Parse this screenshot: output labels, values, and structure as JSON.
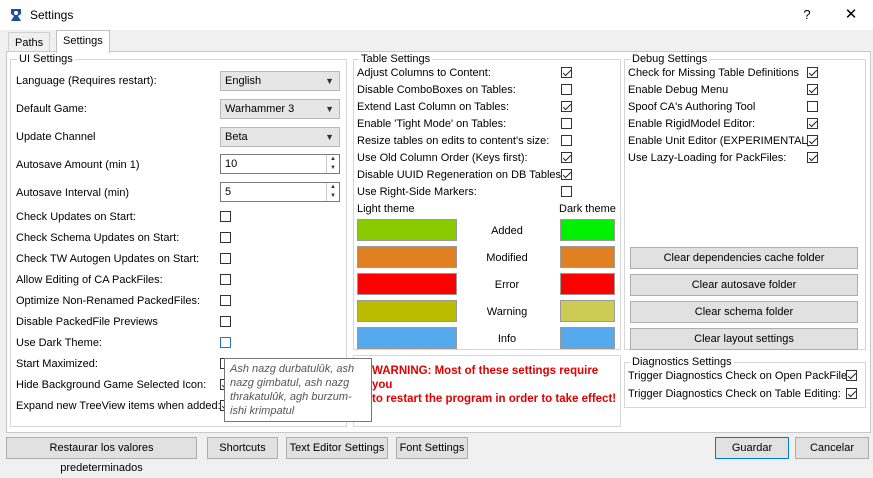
{
  "window": {
    "title": "Settings",
    "help": "?",
    "close": "✕",
    "icon": "app-logo-icon"
  },
  "tabs": [
    {
      "label": "Paths"
    },
    {
      "label": "Settings"
    }
  ],
  "ui_settings": {
    "title": "UI Settings",
    "language": {
      "label": "Language (Requires restart):",
      "value": "English"
    },
    "default_game": {
      "label": "Default Game:",
      "value": "Warhammer 3"
    },
    "update_channel": {
      "label": "Update Channel",
      "value": "Beta"
    },
    "autosave_amount": {
      "label": "Autosave Amount (min 1)",
      "value": "10"
    },
    "autosave_interval": {
      "label": "Autosave Interval (min)",
      "value": "5"
    },
    "checks": [
      {
        "label": "Check Updates on Start:",
        "checked": false
      },
      {
        "label": "Check Schema Updates on Start:",
        "checked": false
      },
      {
        "label": "Check TW Autogen Updates on Start:",
        "checked": false
      },
      {
        "label": "Allow Editing of CA PackFiles:",
        "checked": false
      },
      {
        "label": "Optimize Non-Renamed PackedFiles:",
        "checked": false
      },
      {
        "label": "Disable PackedFile Previews",
        "checked": false
      },
      {
        "label": "Use Dark Theme:",
        "checked": false
      },
      {
        "label": "Start Maximized:",
        "checked": false
      },
      {
        "label": "Hide Background Game Selected Icon:",
        "checked": true
      },
      {
        "label": "Expand new TreeView items when added:",
        "checked": true
      }
    ]
  },
  "table_settings": {
    "title": "Table Settings",
    "checks": [
      {
        "label": "Adjust Columns to Content:",
        "checked": true
      },
      {
        "label": "Disable ComboBoxes on Tables:",
        "checked": false
      },
      {
        "label": "Extend Last Column on Tables:",
        "checked": true
      },
      {
        "label": "Enable 'Tight Mode' on Tables:",
        "checked": false
      },
      {
        "label": "Resize tables on edits to content's size:",
        "checked": false
      },
      {
        "label": "Use Old Column Order (Keys first):",
        "checked": true
      },
      {
        "label": "Disable UUID Regeneration on DB Tables:",
        "checked": true
      },
      {
        "label": "Use Right-Side Markers:",
        "checked": false
      }
    ],
    "light_theme_label": "Light theme",
    "dark_theme_label": "Dark theme",
    "colors": [
      {
        "name": "Added",
        "light": "#88cc00",
        "dark": "#00f000"
      },
      {
        "name": "Modified",
        "light": "#e08020",
        "dark": "#e08020"
      },
      {
        "name": "Error",
        "light": "#ff0000",
        "dark": "#ff0000"
      },
      {
        "name": "Warning",
        "light": "#bbbb00",
        "dark": "#cccc55"
      },
      {
        "name": "Info",
        "light": "#55aaee",
        "dark": "#55aaee"
      }
    ],
    "warning_text_1": "WARNING: Most of these settings require you",
    "warning_text_2": "to restart the program in order to take effect!"
  },
  "debug_settings": {
    "title": "Debug Settings",
    "checks": [
      {
        "label": "Check for Missing Table Definitions",
        "checked": true
      },
      {
        "label": "Enable Debug Menu",
        "checked": true
      },
      {
        "label": "Spoof CA's Authoring Tool",
        "checked": false
      },
      {
        "label": "Enable RigidModel Editor:",
        "checked": true
      },
      {
        "label": "Enable Unit Editor (EXPERIMENTAL):",
        "checked": true
      },
      {
        "label": "Use Lazy-Loading for PackFiles:",
        "checked": true
      }
    ],
    "buttons": [
      "Clear dependencies cache folder",
      "Clear autosave folder",
      "Clear schema folder",
      "Clear layout settings"
    ]
  },
  "diagnostics_settings": {
    "title": "Diagnostics Settings",
    "checks": [
      {
        "label": "Trigger Diagnostics Check on Open PackFile:",
        "checked": true
      },
      {
        "label": "Trigger Diagnostics Check on Table Editing:",
        "checked": true
      }
    ]
  },
  "tooltip": "Ash nazg durbatulûk, ash nazg gimbatul, ash nazg thrakatulûk, agh burzum-ishi krimpatul",
  "bottom_bar": {
    "restore": "Restaurar los valores predeterminados",
    "shortcuts": "Shortcuts",
    "text_editor": "Text Editor Settings",
    "font": "Font Settings",
    "save": "Guardar",
    "cancel": "Cancelar"
  }
}
